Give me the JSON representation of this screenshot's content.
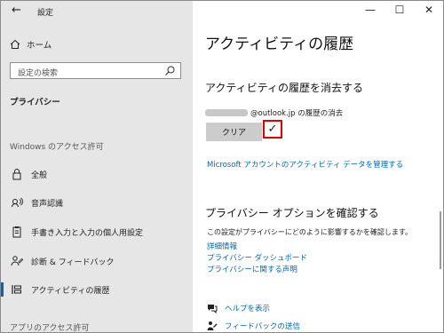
{
  "window": {
    "back_glyph": "←",
    "title": "設定",
    "minimize_glyph": "—",
    "maximize_glyph": "☐",
    "close_glyph": "✕"
  },
  "sidebar": {
    "home_label": "ホーム",
    "search_placeholder": "設定の検索",
    "section_privacy": "プライバシー",
    "section_windows_perm": "Windows のアクセス許可",
    "items": [
      {
        "label": "全般",
        "icon": "lock-icon"
      },
      {
        "label": "音声認識",
        "icon": "speech-icon"
      },
      {
        "label": "手書き入力と入力の個人用設定",
        "icon": "clipboard-icon"
      },
      {
        "label": "診断 & フィードバック",
        "icon": "feedback-person-icon"
      },
      {
        "label": "アクティビティの履歴",
        "icon": "timeline-icon",
        "selected": true
      }
    ],
    "section_app_perm": "アプリのアクセス許可"
  },
  "main": {
    "title": "アクティビティの履歴",
    "clear_heading": "アクティビティの履歴を消去する",
    "account_suffix": "@outlook.jp の履歴の消去",
    "clear_button": "クリア",
    "checkmark": "✓",
    "manage_link": "Microsoft アカウントのアクティビティ データを管理する",
    "privacy_heading": "プライバシー オプションを確認する",
    "privacy_desc": "この設定がプライバシーにどのように影響するかを確認します。",
    "links": [
      "詳細情報",
      "プライバシー ダッシュボード",
      "プライバシーに関する声明"
    ],
    "help_link": "ヘルプを表示",
    "feedback_link": "フィードバックの送信"
  }
}
